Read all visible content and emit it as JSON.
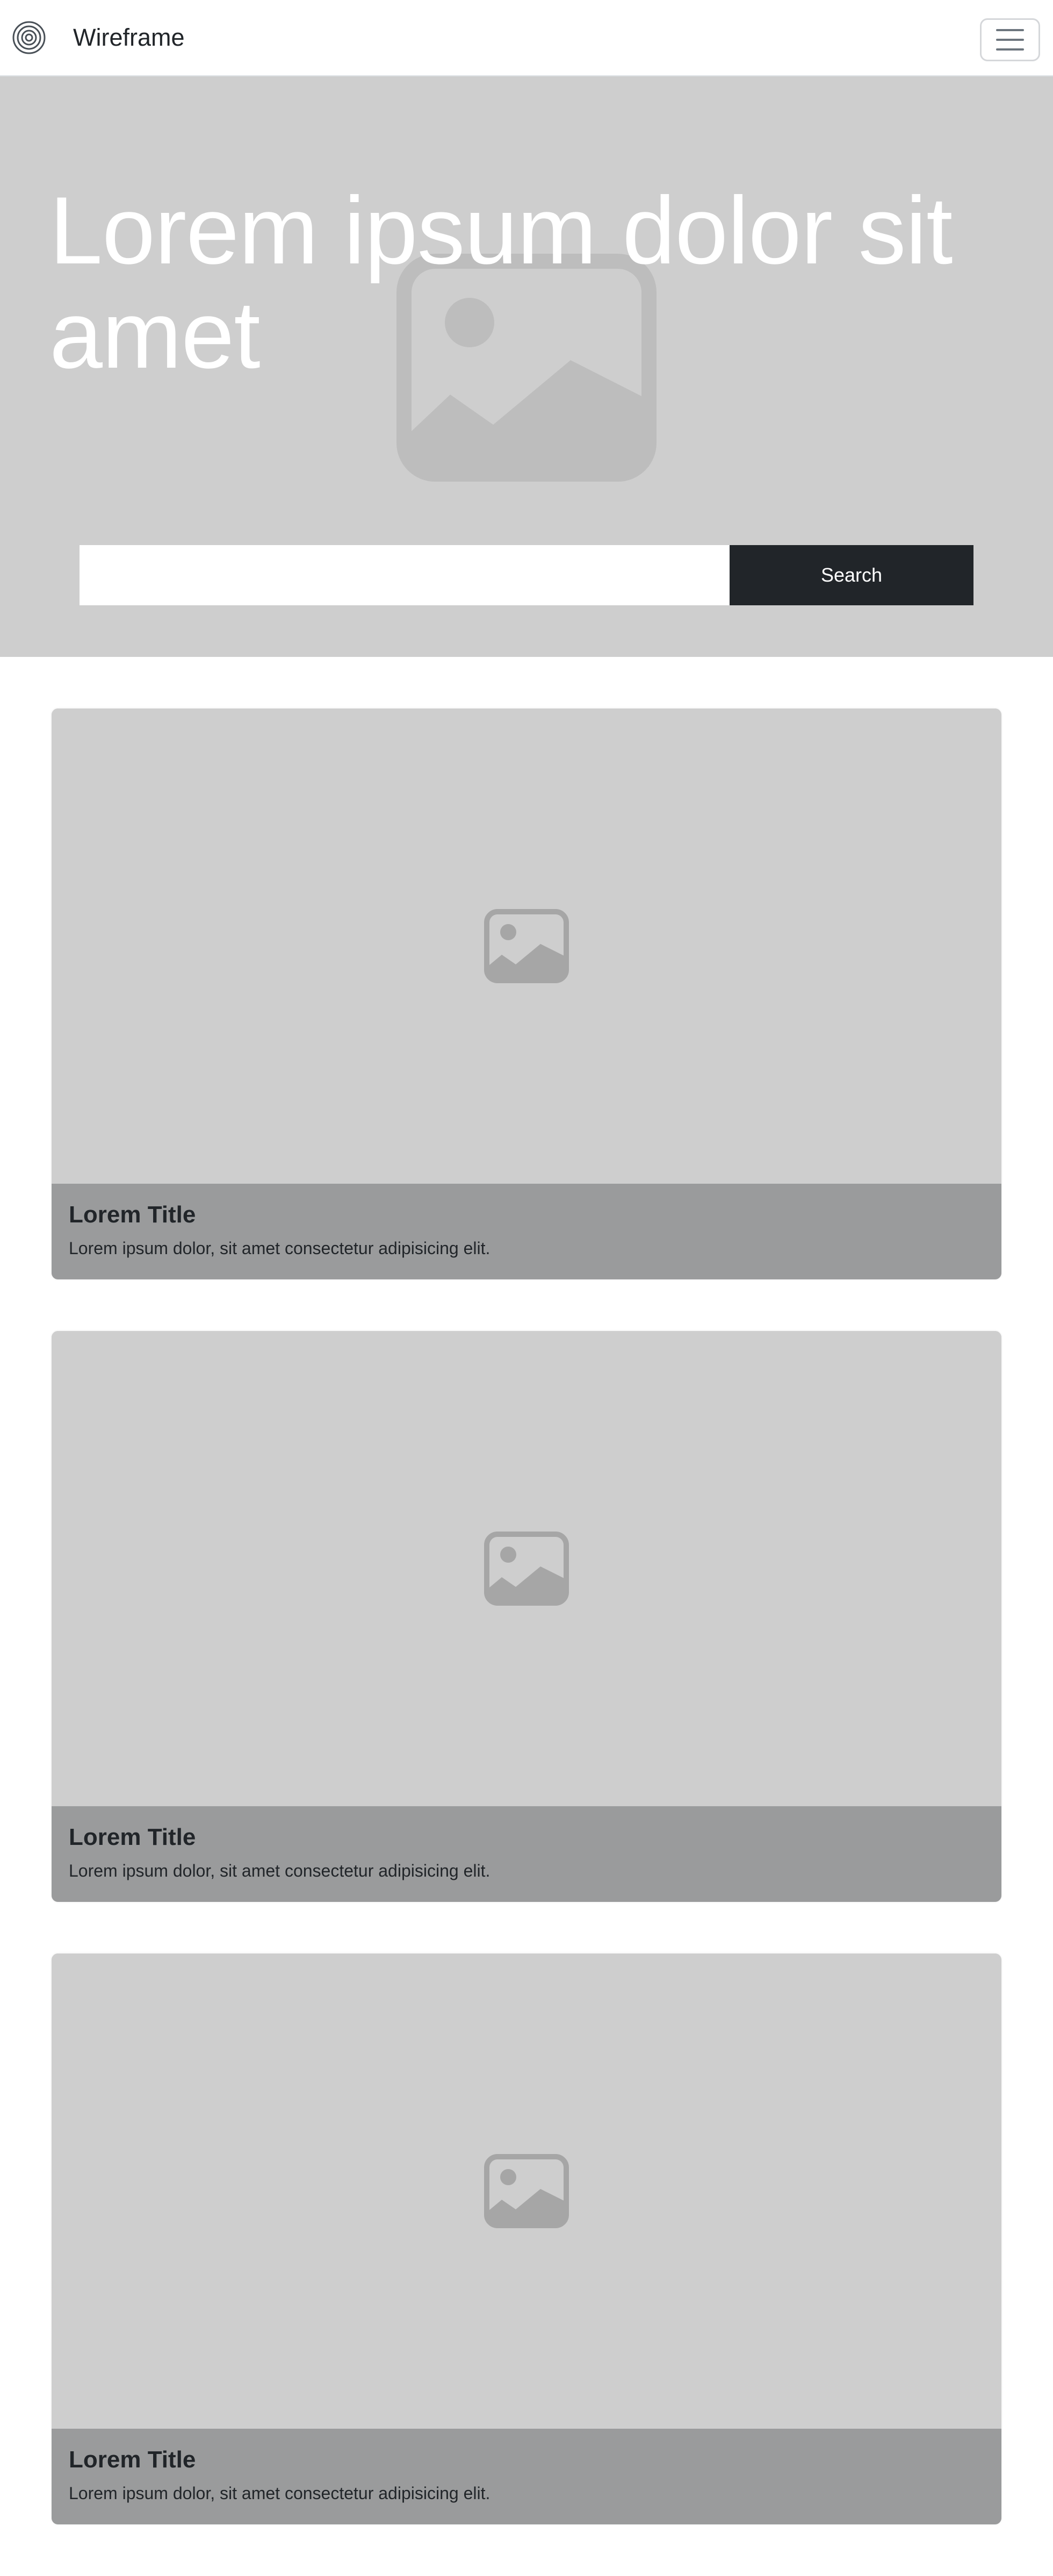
{
  "navbar": {
    "brand_name": "Wireframe",
    "logo_icon": "concentric-circles-icon",
    "menu_icon": "hamburger-menu-icon"
  },
  "hero": {
    "title": "Lorem ipsum dolor sit amet",
    "search": {
      "value": "",
      "placeholder": "",
      "button_label": "Search"
    },
    "background_icon": "image-placeholder-icon"
  },
  "cards": [
    {
      "title": "Lorem Title",
      "text": "Lorem ipsum dolor, sit amet consectetur adipisicing elit.",
      "image_icon": "image-placeholder-icon"
    },
    {
      "title": "Lorem Title",
      "text": "Lorem ipsum dolor, sit amet consectetur adipisicing elit.",
      "image_icon": "image-placeholder-icon"
    },
    {
      "title": "Lorem Title",
      "text": "Lorem ipsum dolor, sit amet consectetur adipisicing elit.",
      "image_icon": "image-placeholder-icon"
    }
  ],
  "colors": {
    "placeholder_bg": "#cecece",
    "caption_bg": "#9a9b9c",
    "button_bg": "#212529",
    "icon_gray": "#a6a6a6"
  }
}
